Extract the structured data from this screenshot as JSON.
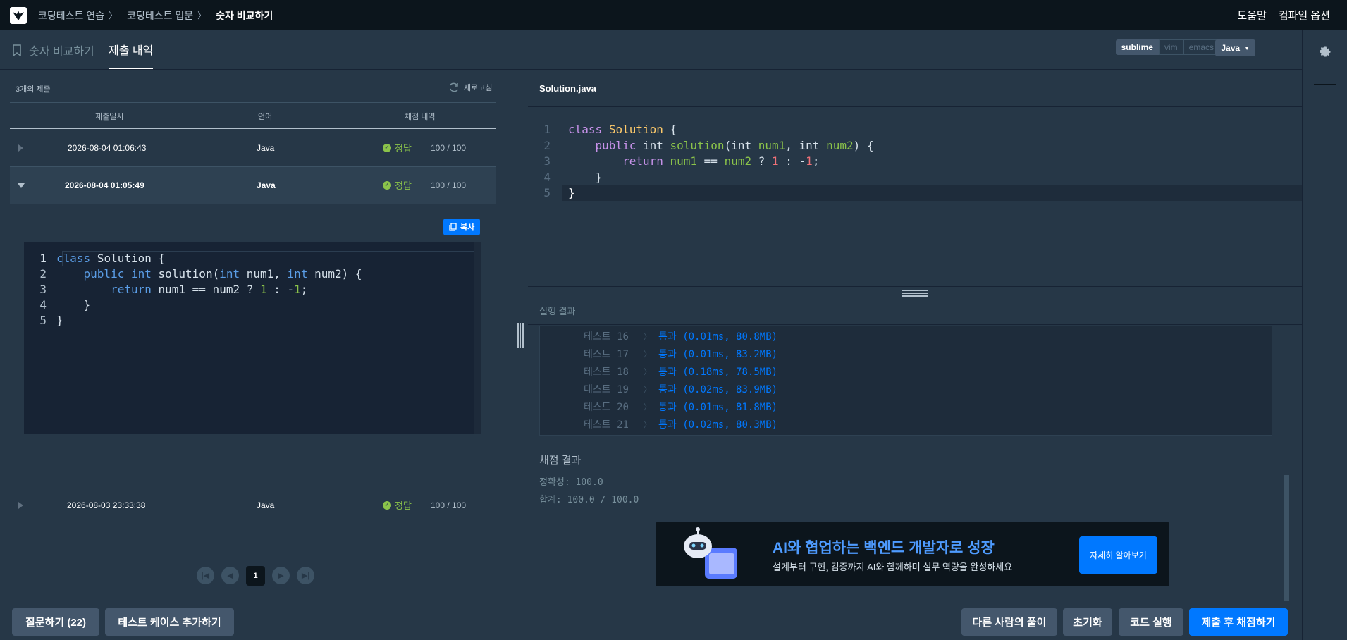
{
  "breadcrumb": [
    "코딩테스트 연습",
    "코딩테스트 입문",
    "숫자 비교하기"
  ],
  "topnav": {
    "help": "도움말",
    "compile_options": "컴파일 옵션"
  },
  "tabs": {
    "problem": "숫자 비교하기",
    "submissions": "제출 내역"
  },
  "editor_modes": [
    "sublime",
    "vim",
    "emacs"
  ],
  "language": "Java",
  "submissions": {
    "count_label": "3개의 제출",
    "refresh_label": "새로고침",
    "columns": [
      "제출일시",
      "언어",
      "채점 내역"
    ],
    "rows": [
      {
        "date": "2026-08-04 01:06:43",
        "lang": "Java",
        "status": "정답",
        "score": "100 / 100"
      },
      {
        "date": "2026-08-04 01:05:49",
        "lang": "Java",
        "status": "정답",
        "score": "100 / 100"
      },
      {
        "date": "2026-08-03 23:33:38",
        "lang": "Java",
        "status": "정답",
        "score": "100 / 100"
      }
    ],
    "copy_label": "복사"
  },
  "code_lines": [
    "1",
    "2",
    "3",
    "4",
    "5"
  ],
  "pagination": {
    "current": "1"
  },
  "file_name": "Solution.java",
  "result_label": "실행 결과",
  "tests": [
    {
      "name": "테스트 16",
      "result": "통과 (0.01ms, 80.8MB)"
    },
    {
      "name": "테스트 17",
      "result": "통과 (0.01ms, 83.2MB)"
    },
    {
      "name": "테스트 18",
      "result": "통과 (0.18ms, 78.5MB)"
    },
    {
      "name": "테스트 19",
      "result": "통과 (0.02ms, 83.9MB)"
    },
    {
      "name": "테스트 20",
      "result": "통과 (0.01ms, 81.8MB)"
    },
    {
      "name": "테스트 21",
      "result": "통과 (0.02ms, 80.3MB)"
    }
  ],
  "grading": {
    "title": "채점 결과",
    "accuracy": "정확성: 100.0",
    "total": "합계: 100.0 / 100.0"
  },
  "banner": {
    "title": "AI와 협업하는 백엔드 개발자로 성장",
    "subtitle": "설계부터 구현, 검증까지 AI와 함께하며 실무 역량을 완성하세요",
    "button": "자세히 알아보기"
  },
  "bottom": {
    "question": "질문하기 (22)",
    "add_testcase": "테스트 케이스 추가하기",
    "others": "다른 사람의 풀이",
    "reset": "초기화",
    "run": "코드 실행",
    "submit": "제출 후 채점하기"
  },
  "colors": {
    "accent": "#0078ff",
    "success": "#8bc34a",
    "bg": "#263747",
    "nav": "#0c151c"
  }
}
